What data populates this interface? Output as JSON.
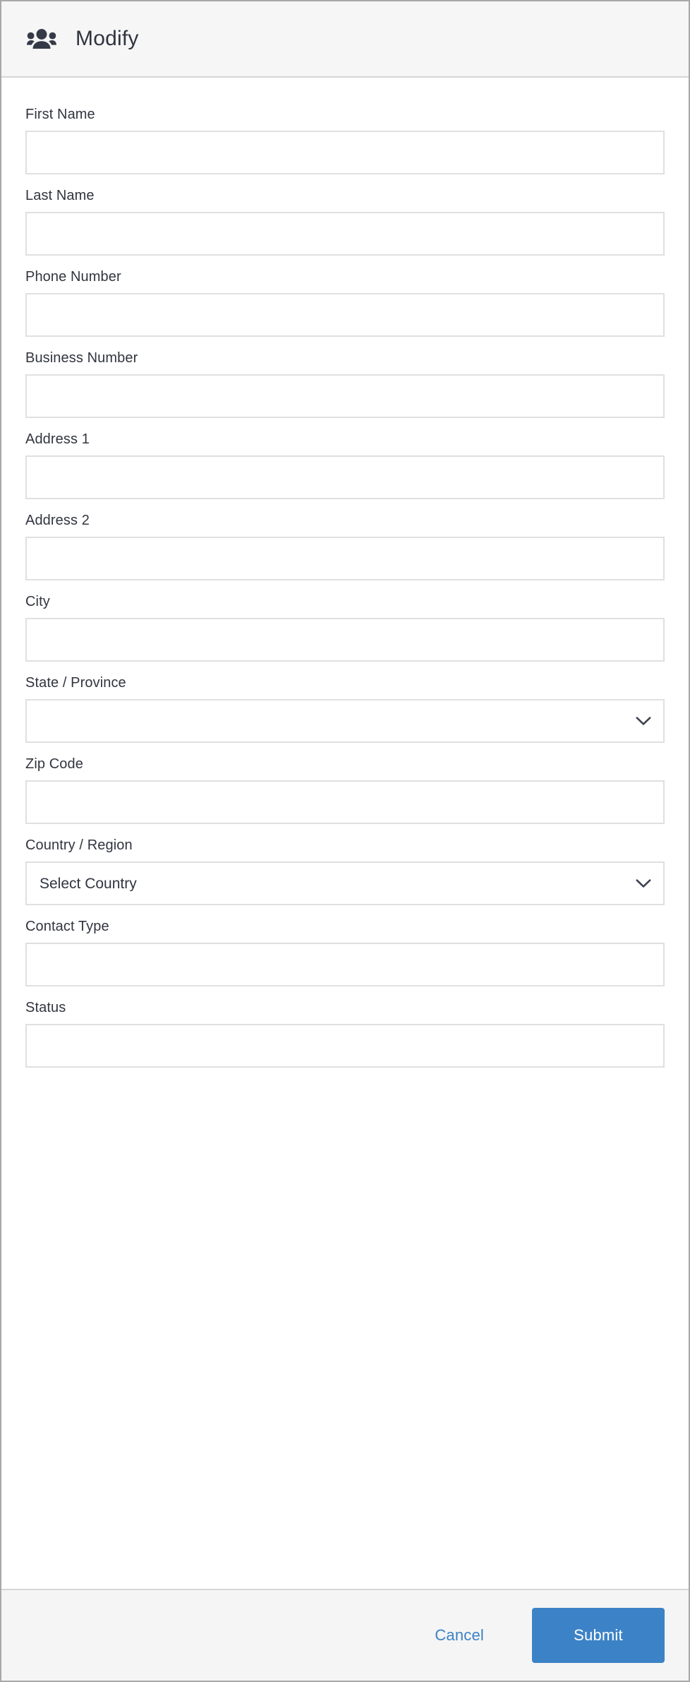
{
  "header": {
    "icon": "people-group-icon",
    "title": "Modify"
  },
  "form": {
    "fields": [
      {
        "label": "First Name",
        "type": "text",
        "value": "",
        "placeholder": ""
      },
      {
        "label": "Last Name",
        "type": "text",
        "value": "",
        "placeholder": ""
      },
      {
        "label": "Phone Number",
        "type": "text",
        "value": "",
        "placeholder": ""
      },
      {
        "label": "Business Number",
        "type": "text",
        "value": "",
        "placeholder": ""
      },
      {
        "label": "Address 1",
        "type": "text",
        "value": "",
        "placeholder": ""
      },
      {
        "label": "Address 2",
        "type": "text",
        "value": "",
        "placeholder": ""
      },
      {
        "label": "City",
        "type": "text",
        "value": "",
        "placeholder": ""
      },
      {
        "label": "State / Province",
        "type": "select",
        "value": "",
        "placeholder": ""
      },
      {
        "label": "Zip Code",
        "type": "text",
        "value": "",
        "placeholder": ""
      },
      {
        "label": "Country / Region",
        "type": "select",
        "value": "Select Country",
        "placeholder": ""
      },
      {
        "label": "Contact Type",
        "type": "text",
        "value": "",
        "placeholder": ""
      },
      {
        "label": "Status",
        "type": "text",
        "value": "",
        "placeholder": ""
      }
    ]
  },
  "footer": {
    "cancel_label": "Cancel",
    "submit_label": "Submit"
  },
  "colors": {
    "accent": "#3c82c6",
    "header_bg": "#f6f6f6",
    "footer_bg": "#f5f5f5",
    "border": "#e0e0e0",
    "text": "#2f3440"
  }
}
